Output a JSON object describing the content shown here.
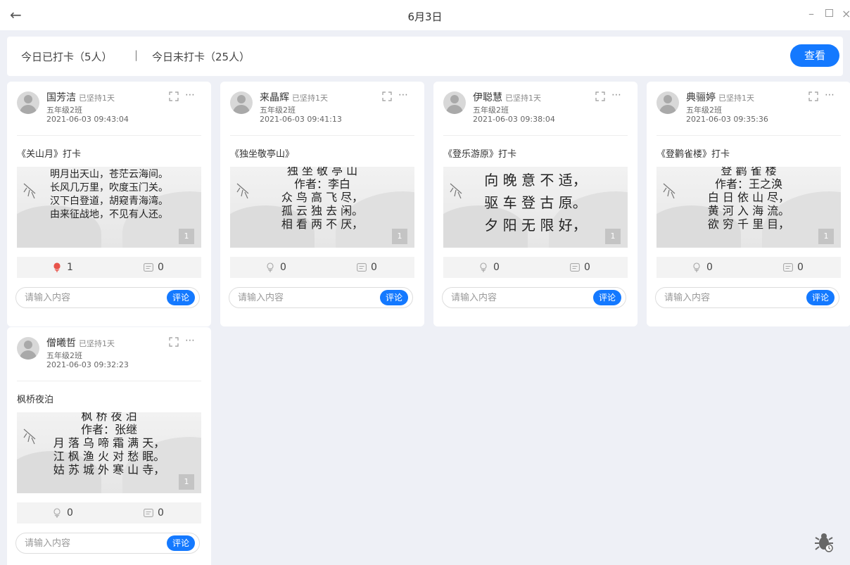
{
  "window": {
    "title": "6月3日"
  },
  "summary": {
    "checked_in": "今日已打卡（5人）",
    "separator": "|",
    "not_checked_in": "今日未打卡（25人）",
    "view_button": "查看"
  },
  "cards": [
    {
      "name": "国芳洁",
      "streak": "已坚持1天",
      "class": "五年级2班",
      "time": "2021-06-03 09:43:04",
      "work_title": "《关山月》打卡",
      "poem_lines": [
        "明月出天山，苍茫云海间。",
        "长风几万里，吹度玉门关。",
        "汉下白登道，胡窥青海湾。",
        "由来征战地，不见有人还。"
      ],
      "page": "1",
      "likes": "1",
      "comments": "0",
      "liked": true,
      "comment_placeholder": "请输入内容",
      "comment_button": "评论"
    },
    {
      "name": "来晶辉",
      "streak": "已坚持1天",
      "class": "五年级2班",
      "time": "2021-06-03 09:41:13",
      "work_title": "《独坐敬亭山》",
      "poem_lines": [
        "独 坐 敬 亭 山",
        "作者：李白",
        "众 鸟 高 飞 尽，",
        "孤 云 独 去 闲。",
        "相 看 两 不 厌，"
      ],
      "page": "1",
      "likes": "0",
      "comments": "0",
      "liked": false,
      "comment_placeholder": "请输入内容",
      "comment_button": "评论"
    },
    {
      "name": "伊聪慧",
      "streak": "已坚持1天",
      "class": "五年级2班",
      "time": "2021-06-03 09:38:04",
      "work_title": "《登乐游原》打卡",
      "poem_lines": [
        "向 晚 意 不 适，",
        "驱 车 登 古 原。",
        "夕 阳 无 限 好，"
      ],
      "page": "1",
      "likes": "0",
      "comments": "0",
      "liked": false,
      "comment_placeholder": "请输入内容",
      "comment_button": "评论"
    },
    {
      "name": "典骊婷",
      "streak": "已坚持1天",
      "class": "五年级2班",
      "time": "2021-06-03 09:35:36",
      "work_title": "《登鹳雀楼》打卡",
      "poem_lines": [
        "登 鹳 雀 楼",
        "作者：王之涣",
        "白 日 依 山 尽，",
        "黄 河 入 海 流。",
        "欲 穷 千 里 目，"
      ],
      "page": "1",
      "likes": "0",
      "comments": "0",
      "liked": false,
      "comment_placeholder": "请输入内容",
      "comment_button": "评论"
    },
    {
      "name": "僧曦哲",
      "streak": "已坚持1天",
      "class": "五年级2班",
      "time": "2021-06-03 09:32:23",
      "work_title": "枫桥夜泊",
      "poem_lines": [
        "枫 桥 夜 泊",
        "作者：张继",
        "月 落 乌 啼 霜 满 天，",
        "江 枫 渔 火 对 愁 眠。",
        "姑 苏 城 外 寒 山 寺，"
      ],
      "page": "1",
      "likes": "0",
      "comments": "0",
      "liked": false,
      "comment_placeholder": "请输入内容",
      "comment_button": "评论"
    }
  ],
  "colors": {
    "accent": "#1479ff",
    "liked_flower": "#e8534a",
    "background": "#eef0f6"
  },
  "icons": {
    "back": "arrow-left-icon",
    "minimize": "minimize-icon",
    "maximize": "maximize-icon",
    "close": "close-icon",
    "expand": "expand-icon",
    "more": "more-icon",
    "like": "flower-icon",
    "comment": "comment-icon",
    "debug": "bug-icon"
  }
}
